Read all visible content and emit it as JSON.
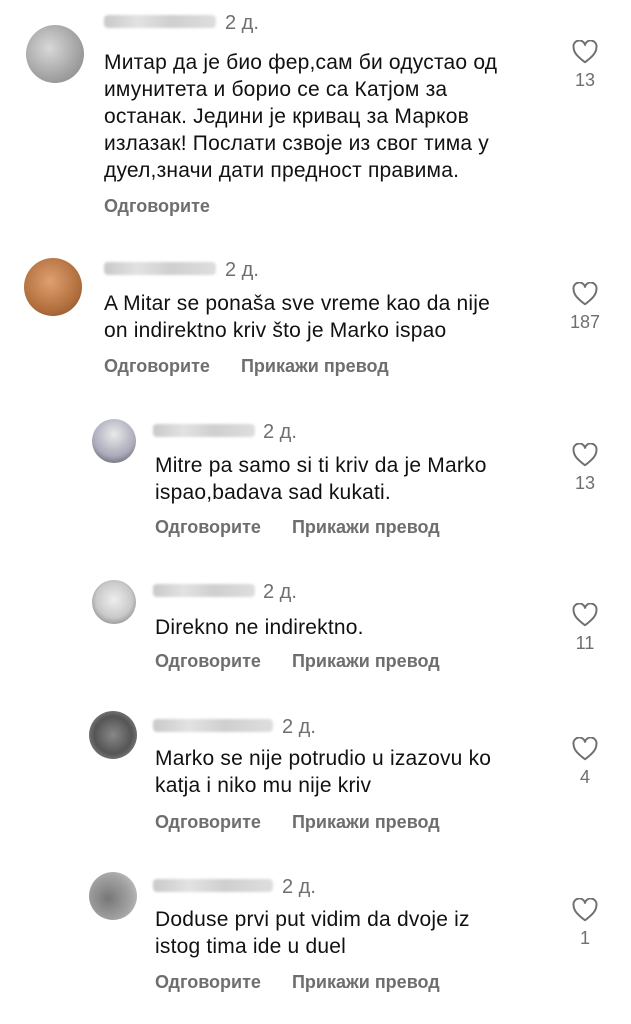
{
  "comments": [
    {
      "time": "2 д.",
      "lines": [
        "Митар да је био фер,сам би одустао од",
        "имунитета и борио се са Катјом за",
        "останак.  Једини је кривац за Марков",
        "излазак! Послати сзвоје из свог тима у",
        "дуел,значи дати предност правима."
      ],
      "reply": "Одговорите",
      "translate": "",
      "likes": "13"
    },
    {
      "time": "2 д.",
      "lines": [
        "A Mitar se ponaša sve vreme kao da nije",
        "on indirektno kriv što je Marko ispao"
      ],
      "reply": "Одговорите",
      "translate": "Прикажи превод",
      "likes": "187"
    },
    {
      "time": "2 д.",
      "lines": [
        "Mitre pa samo si ti kriv da je Marko",
        "ispao,badava sad kukati."
      ],
      "reply": "Одговорите",
      "translate": "Прикажи превод",
      "likes": "13"
    },
    {
      "time": "2 д.",
      "lines": [
        "Direkno ne indirektno."
      ],
      "reply": "Одговорите",
      "translate": "Прикажи превод",
      "likes": "11"
    },
    {
      "time": "2 д.",
      "lines": [
        "Marko se nije potrudio u izazovu ko",
        "katja i niko mu nije kriv"
      ],
      "reply": "Одговорите",
      "translate": "Прикажи превод",
      "likes": "4"
    },
    {
      "time": "2 д.",
      "lines": [
        "Doduse prvi put vidim da dvoje iz",
        "istog tima ide u duel"
      ],
      "reply": "Одговорите",
      "translate": "Прикажи превод",
      "likes": "1"
    }
  ]
}
